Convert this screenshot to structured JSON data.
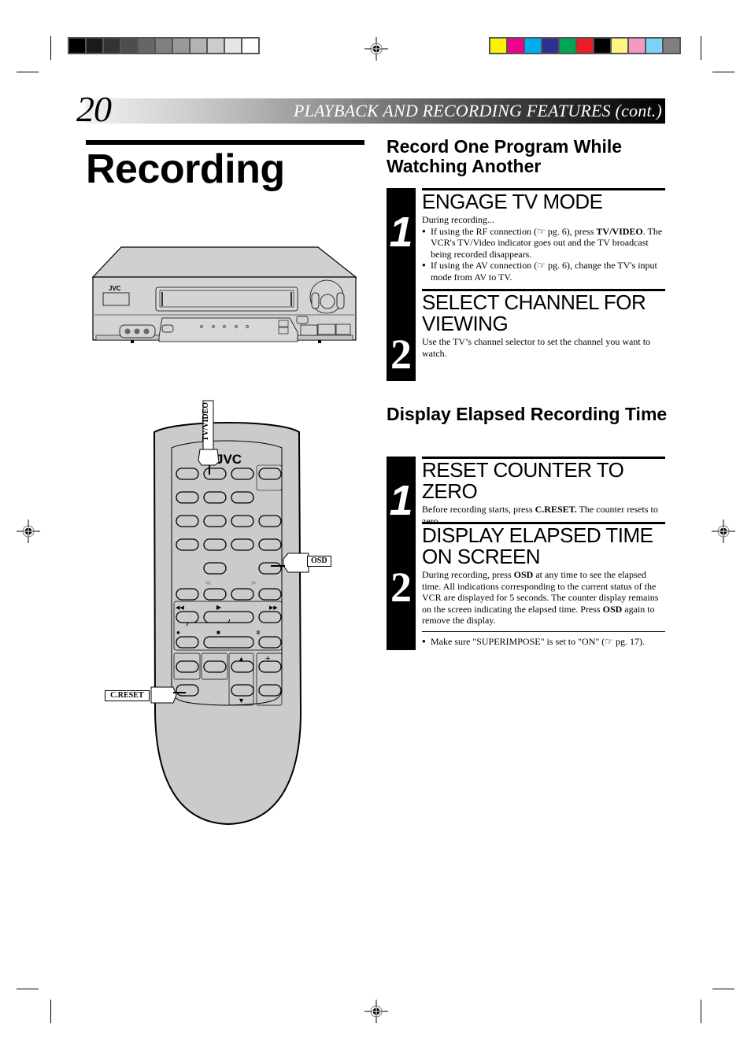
{
  "page": {
    "number": "20",
    "section_header": "PLAYBACK AND RECORDING FEATURES (cont.)",
    "title": "Recording"
  },
  "print_marks": {
    "grayscale_bar": [
      "#000000",
      "#1a1a1a",
      "#333333",
      "#4d4d4d",
      "#666666",
      "#808080",
      "#999999",
      "#b3b3b3",
      "#cccccc",
      "#e6e6e6",
      "#ffffff"
    ],
    "color_bar": [
      "#fff200",
      "#ec008c",
      "#00aeef",
      "#2e3192",
      "#00a651",
      "#ed1c24",
      "#000000",
      "#fff682",
      "#f49ac1",
      "#7dd3f7",
      "#808080"
    ]
  },
  "illustrations": {
    "vcr": {
      "brand": "JVC"
    },
    "remote": {
      "brand": "JVC",
      "callouts": {
        "tv_video": "TV/VIDEO",
        "osd": "OSD",
        "c_reset": "C.RESET"
      },
      "symbols": {
        "rewind": "◀◀",
        "play": "▶",
        "ffwd": "▶▶",
        "record": "●",
        "stop": "■",
        "pause": "II",
        "plus": "+",
        "minus": "−",
        "up": "▲",
        "down": "▼",
        "skip_back": "≪",
        "skip_fwd": "≫"
      }
    }
  },
  "sections": [
    {
      "title": "Record One Program While Watching Another",
      "steps": [
        {
          "number": "1",
          "heading": "ENGAGE TV MODE",
          "intro": "During recording...",
          "bullets": [
            {
              "pre": "If using the RF connection (☞ pg. 6), press ",
              "bold": "TV/VIDEO",
              "post": ". The VCR's TV/Video indicator goes out and the TV broadcast being recorded disappears."
            },
            {
              "pre": "If using the AV connection (☞ pg. 6), change the TV's input mode from AV to TV.",
              "bold": "",
              "post": ""
            }
          ]
        },
        {
          "number": "2",
          "heading": "SELECT CHANNEL FOR VIEWING",
          "body": "Use the TV’s channel selector to set the channel you want to watch."
        }
      ]
    },
    {
      "title": "Display Elapsed Recording Time",
      "steps": [
        {
          "number": "1",
          "heading": "RESET COUNTER TO ZERO",
          "body_pre": "Before recording starts, press ",
          "body_bold": "C.RESET.",
          "body_post": " The counter resets to zero."
        },
        {
          "number": "2",
          "heading": "DISPLAY ELAPSED TIME ON SCREEN",
          "body_pre": "During recording, press ",
          "body_bold": "OSD",
          "body_mid": " at any time to see the elapsed time. All indications corresponding to the current status of the VCR are displayed for 5 seconds. The counter display remains on the screen indicating the elapsed time. Press ",
          "body_bold2": "OSD",
          "body_post": " again to remove the display.",
          "note": "Make sure \"SUPERIMPOSE\" is set to \"ON\" (☞ pg. 17)."
        }
      ]
    }
  ]
}
